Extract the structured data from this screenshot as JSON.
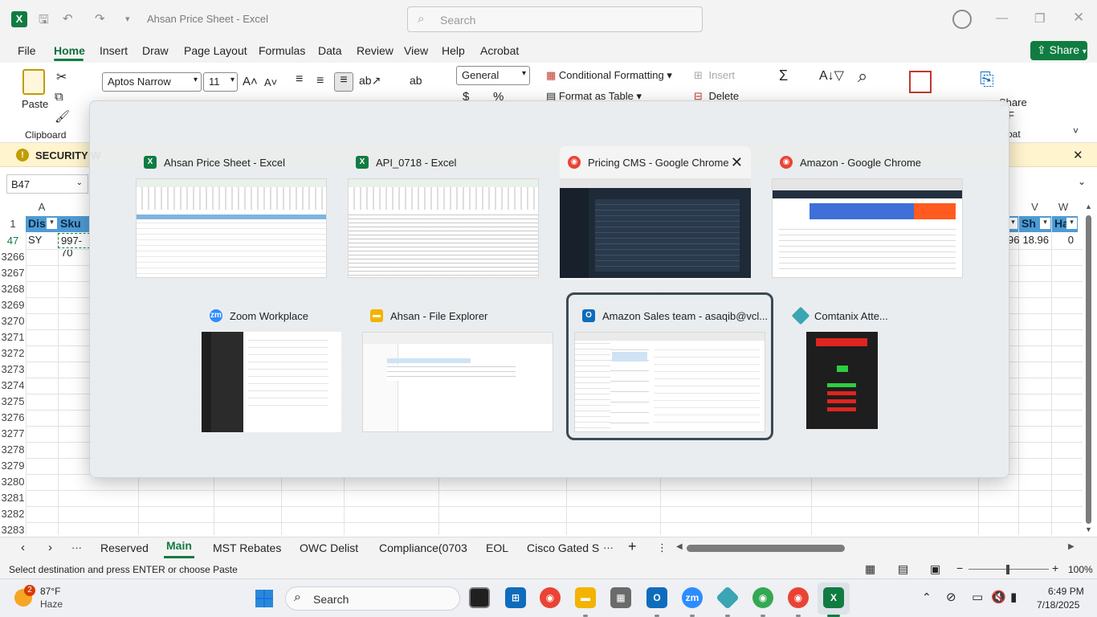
{
  "window": {
    "title": "Ahsan Price Sheet  -  Excel",
    "search_placeholder": "Search"
  },
  "menu": {
    "items": [
      "File",
      "Home",
      "Insert",
      "Draw",
      "Page Layout",
      "Formulas",
      "Data",
      "Review",
      "View",
      "Help",
      "Acrobat"
    ],
    "share_label": "Share"
  },
  "ribbon": {
    "paste": "Paste",
    "clipboard": "Clipboard",
    "font_name": "Aptos Narrow",
    "font_size": "11",
    "number_format": "General",
    "conditional_formatting": "Conditional Formatting",
    "format_as_table": "Format as Table",
    "insert": "Insert",
    "delete": "Delete",
    "group_cut": "Share",
    "acrobat_frag": "F",
    "acrobat_frag2": "oat"
  },
  "security_bar": {
    "text": "SECURITY W"
  },
  "formula_bar": {
    "name_box": "B47"
  },
  "grid": {
    "col_a": "A",
    "col_v": "V",
    "col_w": "W",
    "header_row": "1",
    "header_a": "Dis",
    "header_b": "Sku",
    "header_u": "Sh",
    "header_w": "Ha",
    "data_row": "47",
    "cell_a": "SY",
    "cell_b": "997-70",
    "cell_t": "96",
    "cell_v": "18.96",
    "cell_w": "0",
    "row_numbers": [
      "3266",
      "3267",
      "3268",
      "3269",
      "3270",
      "3271",
      "3272",
      "3273",
      "3274",
      "3275",
      "3276",
      "3277",
      "3278",
      "3279",
      "3280",
      "3281",
      "3282",
      "3283"
    ]
  },
  "switcher": {
    "windows": [
      {
        "title": "Ahsan Price Sheet - Excel",
        "app": "excel",
        "color": "#107c41"
      },
      {
        "title": "API_0718 - Excel",
        "app": "excel",
        "color": "#107c41"
      },
      {
        "title": "Pricing CMS - Google Chrome",
        "app": "chrome",
        "color": "#ea4335"
      },
      {
        "title": "Amazon - Google Chrome",
        "app": "chrome",
        "color": "#ea4335"
      },
      {
        "title": "Zoom Workplace",
        "app": "zoom",
        "color": "#2d8cff"
      },
      {
        "title": "Ahsan - File Explorer",
        "app": "folder",
        "color": "#f2b400"
      },
      {
        "title": "Amazon Sales team - asaqib@vcl...",
        "app": "outlook",
        "color": "#0f6cbd"
      },
      {
        "title": "Comtanix Atte...",
        "app": "comtanix",
        "color": "#3aa5b3"
      }
    ]
  },
  "sheets": {
    "tabs": [
      "Reserved",
      "Main",
      "MST Rebates",
      "OWC Delist",
      "Compliance(0703",
      "EOL",
      "Cisco Gated S"
    ],
    "more": "···",
    "add": "+"
  },
  "status": {
    "message": "Select destination and press ENTER or choose Paste",
    "zoom": "100%"
  },
  "taskbar": {
    "weather_temp": "87°F",
    "weather_desc": "Haze",
    "weather_badge": "2",
    "search": "Search",
    "time": "6:49 PM",
    "date": "7/18/2025"
  }
}
